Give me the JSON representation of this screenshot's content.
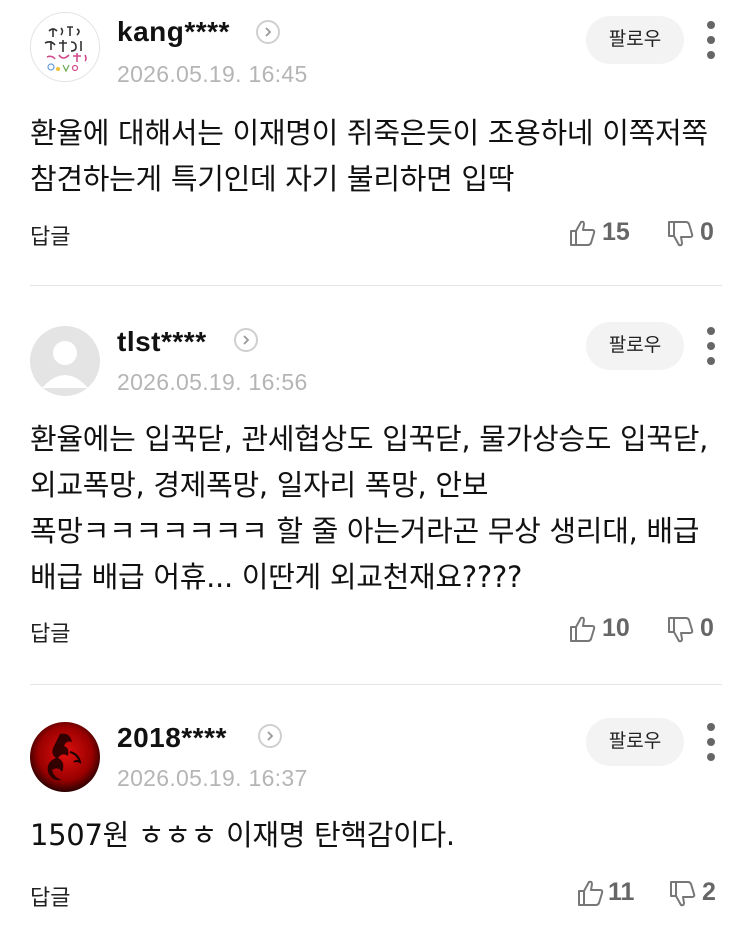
{
  "comments": [
    {
      "nickname": "kang****",
      "date": "2026.05.19. 16:45",
      "follow_label": "팔로우",
      "text": "환율에 대해서는 이재명이 쥐죽은듯이 조용하네 이쪽저쪽 참견하는게 특기인데 자기 불리하면 입딱",
      "reply_label": "답글",
      "likes": "15",
      "dislikes": "0",
      "avatar": {
        "icon": "handwriting-calligraphy-avatar",
        "lettering": "당신을 사랑하고 사랑해요"
      }
    },
    {
      "nickname": "tlst****",
      "date": "2026.05.19. 16:56",
      "follow_label": "팔로우",
      "text": "환율에는 입꾹닫, 관세협상도 입꾹닫, 물가상승도 입꾹닫, 외교폭망, 경제폭망, 일자리 폭망, 안보 폭망ㅋㅋㅋㅋㅋㅋㅋ 할 줄 아는거라곤 무상 생리대, 배급 배급 배급 어휴... 이딴게 외교천재요????",
      "reply_label": "답글",
      "likes": "10",
      "dislikes": "0",
      "avatar": {
        "icon": "default-person-avatar"
      }
    },
    {
      "nickname": "2018****",
      "date": "2026.05.19. 16:37",
      "follow_label": "팔로우",
      "text": "1507원 ㅎㅎㅎ 이재명 탄핵감이다.",
      "reply_label": "답글",
      "likes": "11",
      "dislikes": "2",
      "avatar": {
        "icon": "red-dragon-avatar"
      }
    }
  ],
  "colors": {
    "nickname": "#111111",
    "date": "#b5b5b5",
    "follow_bg": "#f3f3f3",
    "divider": "#e5e5e5",
    "counts": "#666666",
    "dragon_red": "#8b0000"
  }
}
